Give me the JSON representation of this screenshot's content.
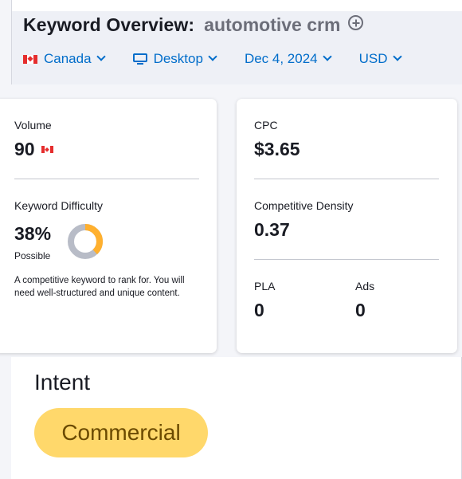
{
  "header": {
    "title_label": "Keyword Overview:",
    "keyword": "automotive crm",
    "filters": {
      "country": "Canada",
      "device": "Desktop",
      "date": "Dec 4, 2024",
      "currency": "USD"
    }
  },
  "metrics_left": {
    "volume_label": "Volume",
    "volume_value": "90",
    "kd_label": "Keyword Difficulty",
    "kd_value": "38%",
    "kd_percent": 38,
    "kd_rating": "Possible",
    "kd_description": "A competitive keyword to rank for. You will need well-structured and unique content."
  },
  "metrics_right": {
    "cpc_label": "CPC",
    "cpc_value": "$3.65",
    "density_label": "Competitive Density",
    "density_value": "0.37",
    "pla_label": "PLA",
    "pla_value": "0",
    "ads_label": "Ads",
    "ads_value": "0"
  },
  "intent": {
    "title": "Intent",
    "badge": "Commercial"
  },
  "colors": {
    "accent_blue": "#006dca",
    "kd_fill": "#ffb02e",
    "kd_track": "#b8bcc7",
    "intent_badge": "#ffd86b"
  },
  "icons": {
    "add": "plus-circle-icon",
    "country": "canada-flag-icon",
    "device": "desktop-monitor-icon",
    "dropdown": "chevron-down-icon"
  }
}
